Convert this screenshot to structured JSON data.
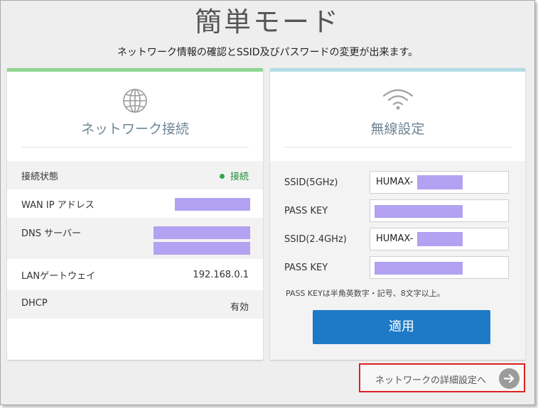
{
  "page": {
    "title": "簡単モード",
    "subtitle": "ネットワーク情報の確認とSSID及びパスワードの変更が出来ます。"
  },
  "network_card": {
    "icon": "globe-icon",
    "title": "ネットワーク接続",
    "rows": [
      {
        "label": "接続状態",
        "value": "接続",
        "status_color": "#2ea84a"
      },
      {
        "label": "WAN IP アドレス",
        "value": ""
      },
      {
        "label": "DNS サーバー",
        "value": ""
      },
      {
        "label": "LANゲートウェイ",
        "value": "192.168.0.1"
      },
      {
        "label": "DHCP",
        "value": "有効"
      }
    ]
  },
  "wireless_card": {
    "icon": "wifi-icon",
    "title": "無線設定",
    "fields": [
      {
        "label": "SSID(5GHz)",
        "value": "HUMAX-"
      },
      {
        "label": "PASS KEY",
        "value": ""
      },
      {
        "label": "SSID(2.4GHz)",
        "value": "HUMAX-"
      },
      {
        "label": "PASS KEY",
        "value": ""
      }
    ],
    "note": "PASS KEYは半角英数字・記号、8文字以上。",
    "apply_label": "適用"
  },
  "detail_link": {
    "label": "ネットワークの詳細設定へ",
    "icon": "arrow-right-icon"
  },
  "colors": {
    "accent_green": "#8fd58f",
    "accent_blue": "#b4dbe6",
    "primary_button": "#1e7ac7",
    "highlight_border": "#e02020"
  }
}
